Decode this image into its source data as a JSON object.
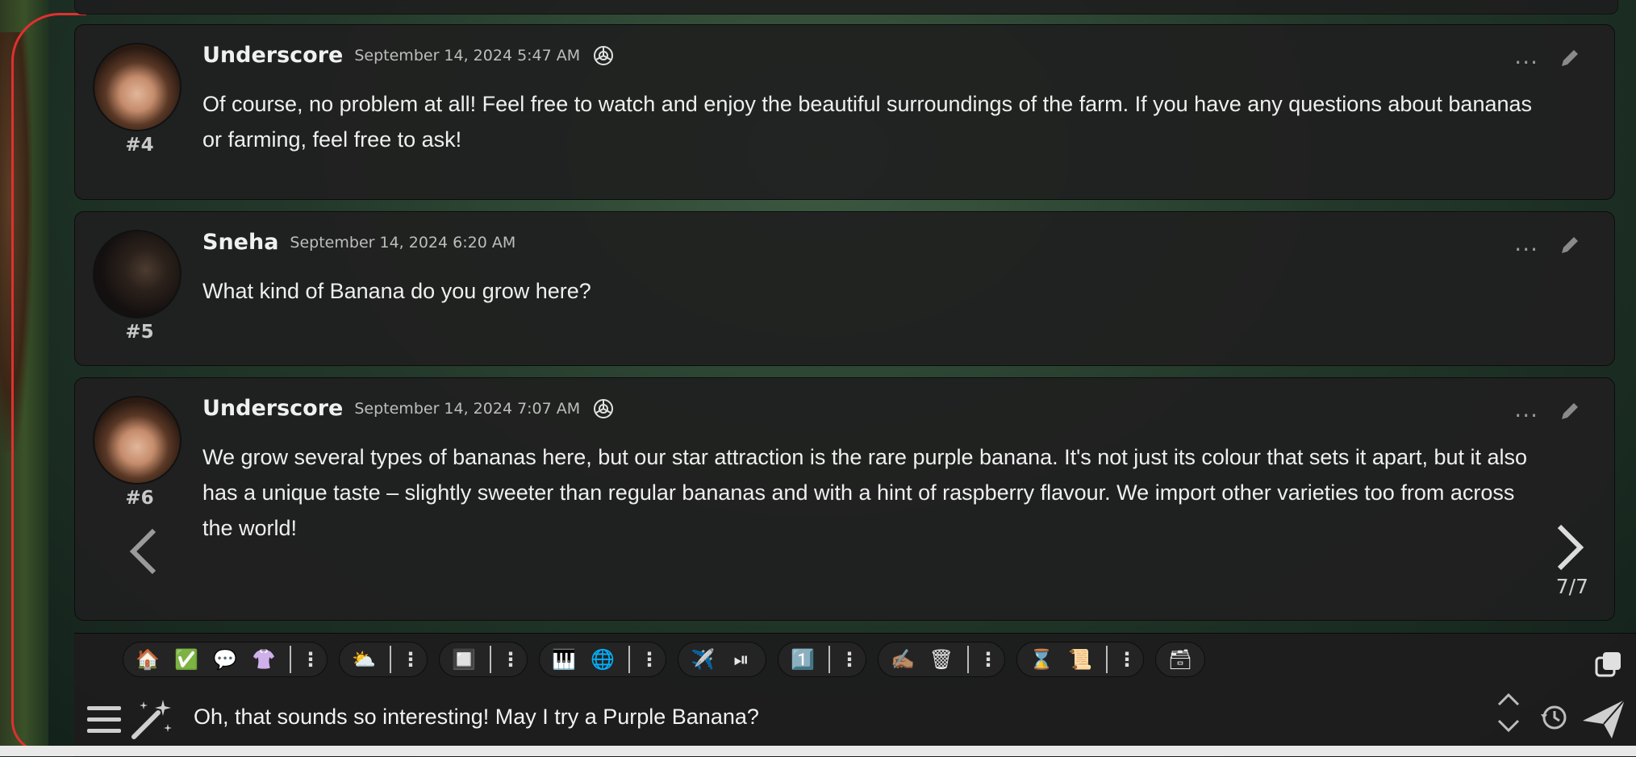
{
  "messages": [
    {
      "name": "Underscore",
      "date": "September 14, 2024 5:47 AM",
      "num": "#4",
      "text": "Of course, no problem at all! Feel free to watch and enjoy the beautiful surroundings of the farm. If you have any questions about bananas or farming, feel free to ask!",
      "ai_icon": true
    },
    {
      "name": "Sneha",
      "date": "September 14, 2024 6:20 AM",
      "num": "#5",
      "text": "What kind of Banana do you grow here?",
      "ai_icon": false
    },
    {
      "name": "Underscore",
      "date": "September 14, 2024 7:07 AM",
      "num": "#6",
      "text": "We grow several types of bananas here, but our star attraction is the rare purple banana. It's not just its colour that sets it apart, but it also has a unique taste – slightly sweeter than regular bananas and with a hint of raspberry flavour. We import other varieties too from across the world!",
      "ai_icon": true,
      "swipe_counter": "7/7"
    }
  ],
  "message_menu": "···",
  "toolbar": {
    "icons": [
      "home-icon",
      "checkbox-icon",
      "speech-bubble-icon",
      "tshirt-icon",
      "weather-icon",
      "dashboard-icon",
      "piano-icon",
      "globe-icon",
      "airplane-icon",
      "play-pause-icon",
      "number-one-icon",
      "writing-hand-icon",
      "wastebasket-icon",
      "hourglass-icon",
      "scroll-icon",
      "card-box-icon"
    ],
    "kebab": "⋮"
  },
  "input": {
    "value": "Oh, that sounds so interesting! May I try a Purple Banana?"
  }
}
